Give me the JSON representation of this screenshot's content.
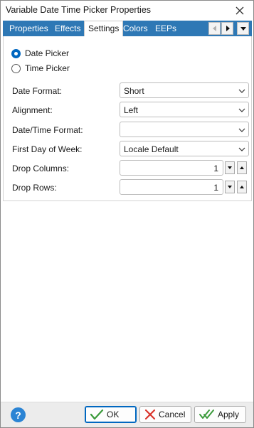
{
  "window": {
    "title": "Variable Date Time Picker Properties",
    "close_glyph": "✕"
  },
  "tabs": [
    {
      "label": "Properties",
      "active": false
    },
    {
      "label": "Effects",
      "active": false
    },
    {
      "label": "Settings",
      "active": true
    },
    {
      "label": "Colors",
      "active": false
    },
    {
      "label": "EEPs",
      "active": false
    }
  ],
  "settings": {
    "mode_options": [
      {
        "label": "Date Picker",
        "checked": true
      },
      {
        "label": "Time Picker",
        "checked": false
      }
    ],
    "fields": {
      "date_format": {
        "label": "Date Format:",
        "value": "Short"
      },
      "alignment": {
        "label": "Alignment:",
        "value": "Left"
      },
      "datetime_format": {
        "label": "Date/Time Format:",
        "value": ""
      },
      "first_day": {
        "label": "First Day of Week:",
        "value": "Locale Default"
      },
      "drop_columns": {
        "label": "Drop Columns:",
        "value": "1"
      },
      "drop_rows": {
        "label": "Drop Rows:",
        "value": "1"
      }
    }
  },
  "footer": {
    "help_glyph": "?",
    "ok_label": "OK",
    "cancel_label": "Cancel",
    "apply_label": "Apply"
  },
  "colors": {
    "tab_bar": "#2e78b5",
    "accent": "#0067c0",
    "ok_check": "#3a9a3a",
    "cancel_x": "#d9342b"
  },
  "icons": [
    "close-icon",
    "scroll-left-icon",
    "scroll-right-icon",
    "dropdown-icon",
    "chevron-down-icon",
    "spin-down-icon",
    "spin-up-icon",
    "help-icon",
    "check-icon",
    "x-icon",
    "double-check-icon"
  ]
}
